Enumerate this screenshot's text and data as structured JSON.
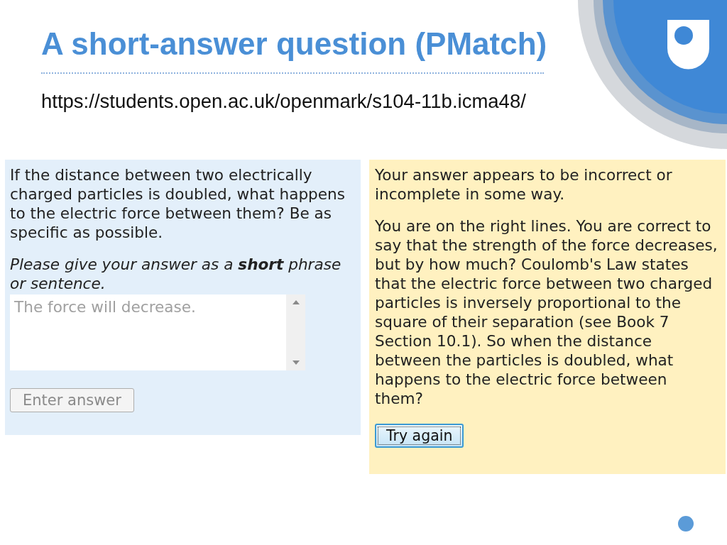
{
  "slide_title": "A short-answer question (PMatch)",
  "url": "https://students.open.ac.uk/openmark/s104-11b.icma48/",
  "question": {
    "text": "If the distance between two electrically charged particles is doubled, what happens to the electric force between them? Be as specific as possible.",
    "instruction": "Please give your answer as a **short** phrase or sentence.",
    "answer": {
      "value": "The force will decrease.",
      "disabled": true
    },
    "button": {
      "label": "Enter answer",
      "disabled": true
    }
  },
  "feedback": {
    "summary": "Your answer appears to be incorrect or incomplete in some way.",
    "detail": "You are on the right lines. You are correct to say that the strength of the force decreases, but by how much? Coulomb's Law states that the electric force between two charged particles is inversely proportional to the square of their separation (see Book 7 Section 10.1). So when the distance between the particles is doubled, what happens to the electric force between them?",
    "button": {
      "label": "Try again",
      "focused": true
    }
  }
}
